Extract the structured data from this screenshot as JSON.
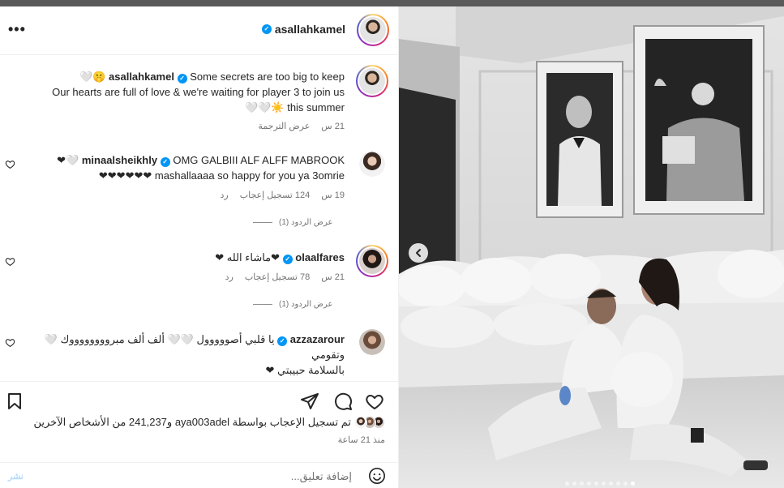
{
  "header": {
    "username": "asallahkamel",
    "more_icon": "more-horizontal-icon"
  },
  "caption": {
    "username": "asallahkamel",
    "line1": "Some secrets are too big to keep 🤫🤍",
    "line2": "Our hearts are full of love & we're waiting for player 3 to join us",
    "line3": "this summer ☀️🤍🤍",
    "time": "21 س",
    "translate": "عرض الترجمة"
  },
  "comments": [
    {
      "username": "minaalsheikhly",
      "line1": "OMG GALBIII ALF ALFF MABROOK 🤍❤",
      "line2": "mashallaaaa so happy for you ya 3omrie ❤❤❤❤❤❤",
      "time": "19 س",
      "likes": "124 تسجيل إعجاب",
      "reply": "رد",
      "view_replies": "عرض الردود (1)"
    },
    {
      "username": "olaalfares",
      "line1": "❤ماشاء الله ❤",
      "time": "21 س",
      "likes": "78 تسجيل إعجاب",
      "reply": "رد",
      "view_replies": "عرض الردود (1)"
    },
    {
      "username": "azzazarour",
      "line1": "يا قلبي أصووووول 🤍🤍 ألف ألف مبرووووووووك 🤍 وتقومي",
      "line2": "بالسلامة حبيبتي ❤"
    }
  ],
  "likes": {
    "text": "تم تسجيل الإعجاب بواسطة aya003adel و241,237 من الأشخاص الآخرين"
  },
  "time_ago": "منذ 21 ساعة",
  "add_comment": {
    "placeholder": "إضافة تعليق...",
    "post_label": "نشر"
  },
  "carousel": {
    "total_slides": 10,
    "active_slide": 10
  },
  "colors": {
    "verified": "#0095f6",
    "secondary_text": "#737373",
    "post_button_disabled": "#b3dbff"
  }
}
